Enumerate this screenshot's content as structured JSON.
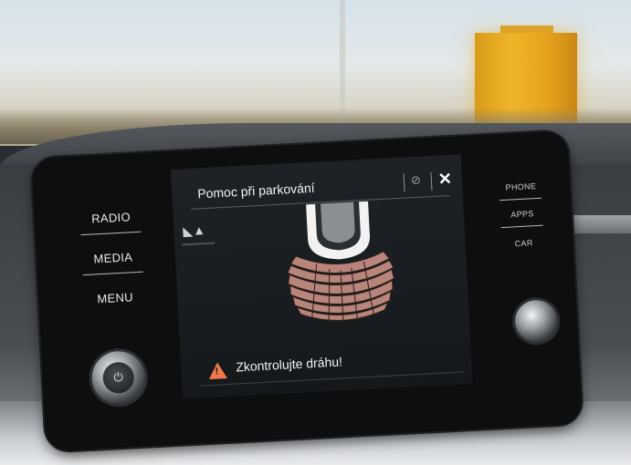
{
  "screen": {
    "title": "Pomoc při parkování",
    "warning": "Zkontrolujte dráhu!"
  },
  "left_buttons": [
    "RADIO",
    "MEDIA",
    "MENU"
  ],
  "right_buttons": [
    "PHONE",
    "APPS",
    "CAR"
  ],
  "icons": {
    "sensor_mute": "sensor-off-icon",
    "close": "close-icon",
    "mode": "parking-mode-icon",
    "warning": "warning-triangle-icon",
    "power": "power-icon"
  },
  "colors": {
    "warning": "#f07a4c",
    "zone": "#b9857a",
    "screen_bg": "#1a1d21"
  }
}
